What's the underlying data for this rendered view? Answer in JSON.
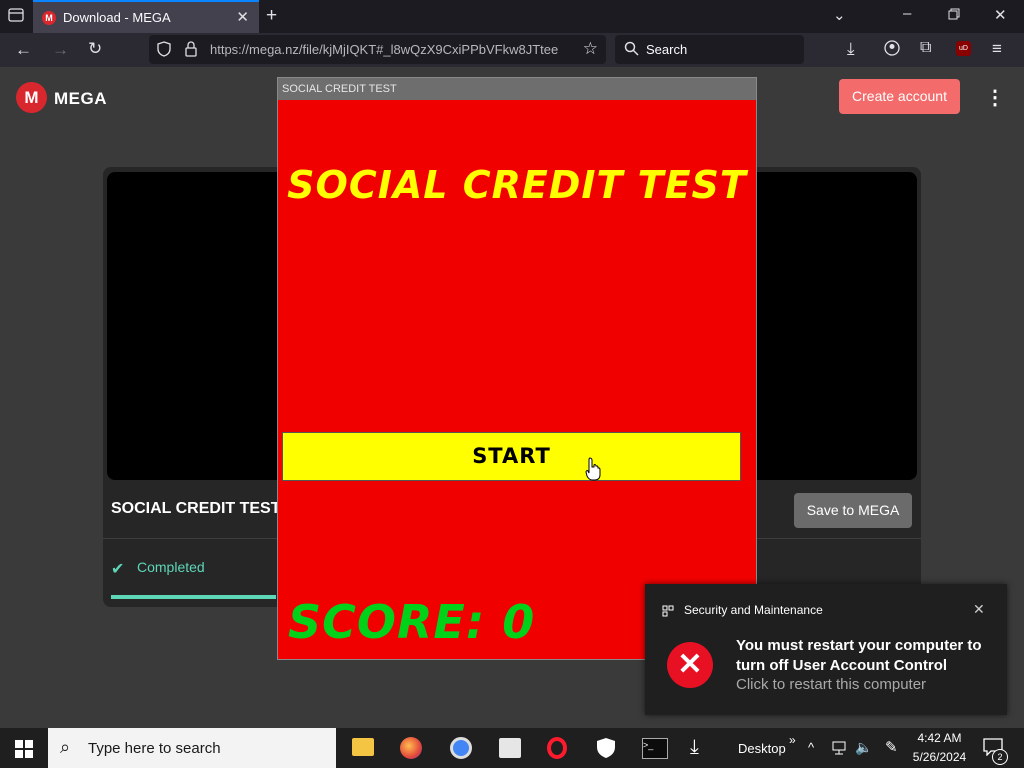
{
  "browser": {
    "tab_title": "Download - MEGA",
    "tab_favicon": "M",
    "url": "https://mega.nz/file/kjMjIQKT#_l8wQzX9CxiPPbVFkw8JTtee",
    "search_placeholder": "Search"
  },
  "mega": {
    "logo_letter": "M",
    "brand": "MEGA",
    "create_account": "Create account",
    "file_name": "SOCIAL CREDIT TEST",
    "save_button": "Save to MEGA",
    "status": "Completed",
    "accent_color": "#d9272e"
  },
  "game": {
    "window_title": "SOCIAL CREDIT TEST",
    "heading": "SOCIAL CREDIT TEST",
    "start_button": "START",
    "score_text": "SCORE: 0",
    "bg_color": "#f10000",
    "heading_color": "#ffff00",
    "score_color": "#00d219"
  },
  "toast": {
    "app": "Security and Maintenance",
    "title": "You must restart your computer to turn off User Account Control",
    "subtitle": "Click to restart this computer"
  },
  "taskbar": {
    "search_placeholder": "Type here to search",
    "desktop_label": "Desktop",
    "time": "4:42 AM",
    "date": "5/26/2024",
    "notification_count": "2"
  }
}
